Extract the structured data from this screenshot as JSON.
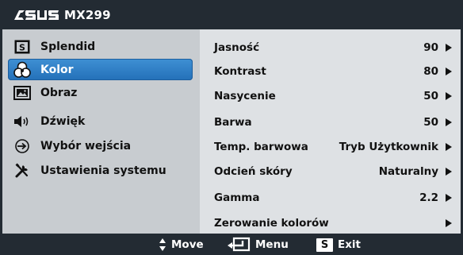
{
  "header": {
    "brand": "ASUS",
    "model": "MX299"
  },
  "sidebar": {
    "items": [
      {
        "label": "Splendid",
        "icon": "splendid-s-icon",
        "active": false
      },
      {
        "label": "Kolor",
        "icon": "color-circles-icon",
        "active": true
      },
      {
        "label": "Obraz",
        "icon": "picture-icon",
        "active": false
      },
      {
        "label": "Dźwięk",
        "icon": "speaker-icon",
        "active": false
      },
      {
        "label": "Wybór wejścia",
        "icon": "input-select-icon",
        "active": false
      },
      {
        "label": "Ustawienia systemu",
        "icon": "tools-icon",
        "active": false
      }
    ]
  },
  "settings": {
    "rows": [
      {
        "label": "Jasność",
        "value": "90"
      },
      {
        "label": "Kontrast",
        "value": "80"
      },
      {
        "label": "Nasycenie",
        "value": "50"
      },
      {
        "label": "Barwa",
        "value": "50"
      },
      {
        "label": "Temp. barwowa",
        "value": "Tryb Użytkownik"
      },
      {
        "label": "Odcień skóry",
        "value": "Naturalny"
      },
      {
        "label": "Gamma",
        "value": "2.2"
      },
      {
        "label": "Zerowanie kolorów",
        "value": ""
      }
    ]
  },
  "footer": {
    "move_label": "Move",
    "menu_label": "Menu",
    "exit_key": "S",
    "exit_label": "Exit"
  },
  "colors": {
    "background": "#232b33",
    "sidebar": "#c8ccd0",
    "content": "#dee1e4",
    "active": "#2f7fc6"
  }
}
